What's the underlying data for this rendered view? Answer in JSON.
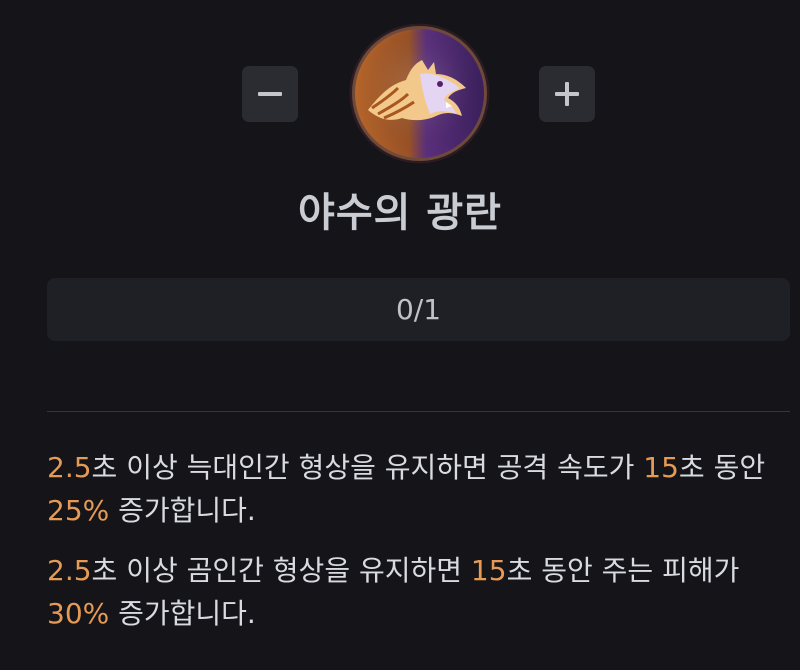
{
  "skill": {
    "name": "야수의 광란",
    "rank": "0/1",
    "emblem_icon": "werewolf-head-icon",
    "colors": {
      "accent": "#e59a55",
      "background": "#141419",
      "button": "#2a2c32",
      "panel": "#1f2025",
      "emblem_orange": "#c8742c",
      "emblem_purple": "#6a3a9c"
    }
  },
  "controls": {
    "decrease_icon": "minus-icon",
    "increase_icon": "plus-icon"
  },
  "descriptions": [
    {
      "t1": "2.5",
      "t2": "초 이상 늑대인간 형상을 유지하면 공격 속도가 ",
      "t3": "15",
      "t4": "초 동안 ",
      "t5": "25%",
      "t6": " 증가합니다."
    },
    {
      "t1": "2.5",
      "t2": "초 이상 곰인간 형상을 유지하면 ",
      "t3": "15",
      "t4": "초 동안 주는 피해가 ",
      "t5": "30%",
      "t6": " 증가합니다."
    }
  ]
}
